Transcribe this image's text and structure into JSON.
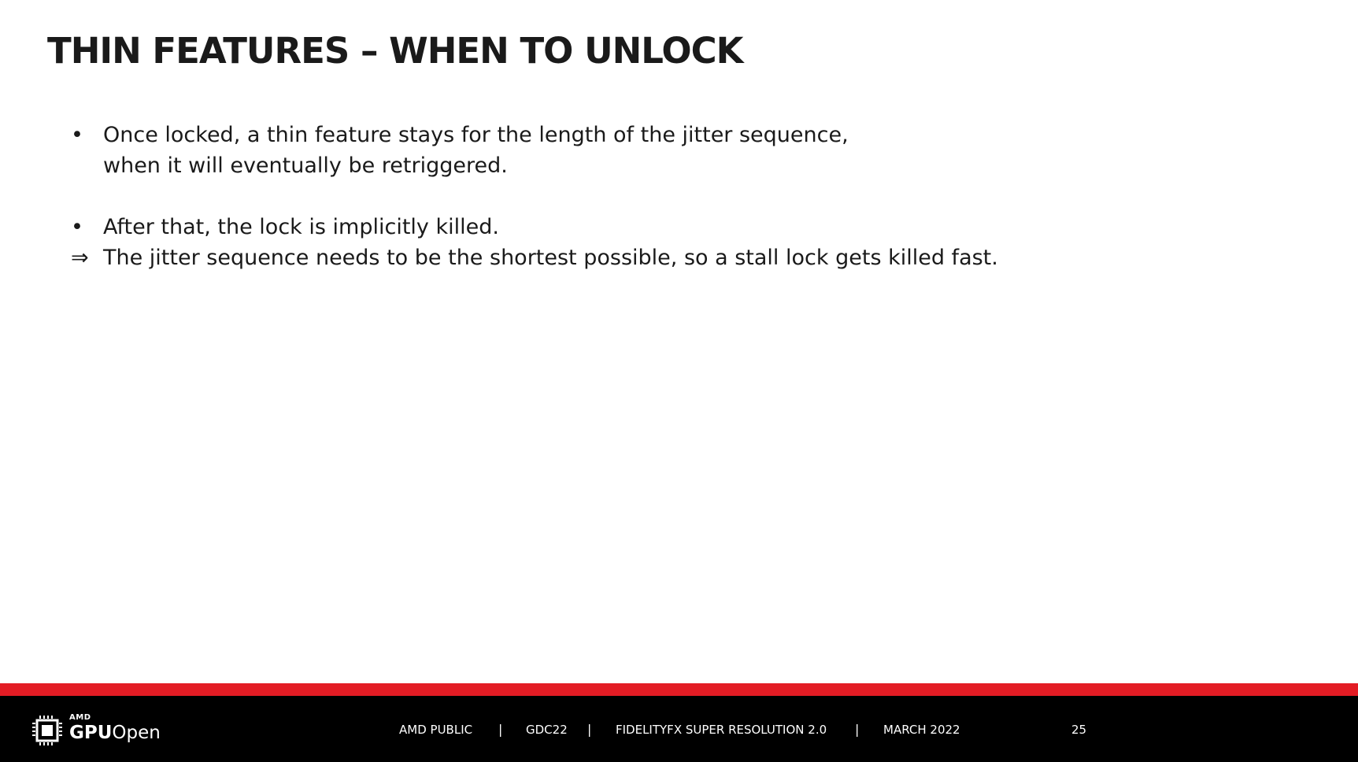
{
  "slide": {
    "title": "THIN FEATURES – WHEN TO UNLOCK",
    "items": [
      {
        "marker": "•",
        "lines": [
          "Once locked, a thin feature stays for the length of the jitter sequence,",
          "when it will eventually be retriggered."
        ]
      },
      {
        "marker": "•",
        "lines": [
          "After that, the lock is implicitly killed."
        ]
      },
      {
        "marker": "⇒",
        "lines": [
          "The jitter sequence needs to be the shortest possible, so a stall lock gets killed fast."
        ]
      }
    ]
  },
  "footer": {
    "logo_amd": "AMD",
    "logo_gpu": "GPU",
    "logo_open": "Open",
    "classification": "AMD PUBLIC",
    "event": "GDC22",
    "topic": "FIDELITYFX SUPER RESOLUTION 2.0",
    "date": "MARCH 2022",
    "page_number": "25",
    "separator": "|"
  },
  "colors": {
    "accent_red": "#e31c24",
    "footer_bg": "#000000",
    "text": "#1a1a1a"
  }
}
